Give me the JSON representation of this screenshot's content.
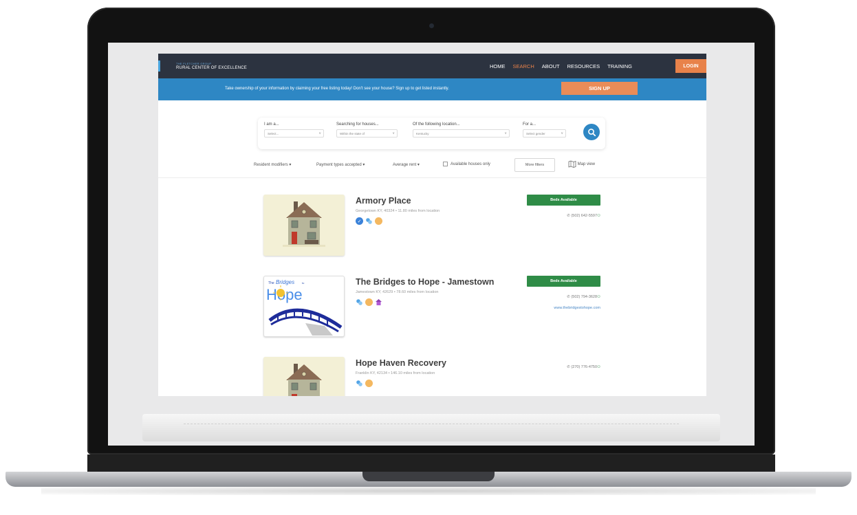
{
  "header": {
    "brand_small": "THE FLETCHER GROUP",
    "brand_name": "RURAL CENTER OF EXCELLENCE",
    "nav": [
      "HOME",
      "SEARCH",
      "ABOUT",
      "RESOURCES",
      "TRAINING"
    ],
    "active_nav": "SEARCH",
    "login_label": "LOGIN"
  },
  "banner": {
    "text": "Take ownership of your information by claiming your free listing today!  Don't see your house? Sign up to get listed instantly.",
    "signup_label": "SIGN UP"
  },
  "search": {
    "fields": [
      {
        "label": "I am a...",
        "value": "Select..."
      },
      {
        "label": "Searching for houses...",
        "value": "Within the state of"
      },
      {
        "label": "Of the following location...",
        "value": "Kentucky"
      },
      {
        "label": "For a...",
        "value": "Select gender"
      }
    ],
    "button_icon": "search-icon"
  },
  "filters": {
    "resident_modifiers": "Resident modifiers",
    "payment_types": "Payment types accepted",
    "average_rent": "Average rent",
    "available_only": "Available houses only",
    "more_filters": "More filters",
    "map_view": "Map view"
  },
  "listings": [
    {
      "name": "Armory Place",
      "meta": "Georgetown KY, 40324 • 11.80 miles from location",
      "status": "Beds Available",
      "phone": "(502) 642-5597",
      "website": "",
      "icons": [
        "verified-icon",
        "medication-icon",
        "payment-icon"
      ]
    },
    {
      "name": "The Bridges to Hope - Jamestown",
      "meta": "Jamestown KY, 42629 • 78.60 miles from location",
      "status": "Beds Available",
      "phone": "(502) 794-3628",
      "website": "www.thebridgestohope.com",
      "icons": [
        "medication-icon",
        "payment-icon",
        "housing-icon"
      ],
      "logo_text": {
        "the": "The",
        "bridges": "Bridges",
        "to": "to",
        "hope": "Hope"
      }
    },
    {
      "name": "Hope Haven Recovery",
      "meta": "Franklin KY, 42134 • 146.10 miles from location",
      "status": "",
      "phone": "(270) 776-4750",
      "website": "",
      "icons": [
        "medication-icon",
        "payment-icon"
      ]
    }
  ],
  "colors": {
    "nav_bg": "#2c3340",
    "accent_orange": "#e8824a",
    "banner_blue": "#2e87c4",
    "beds_green": "#2f8c47"
  }
}
